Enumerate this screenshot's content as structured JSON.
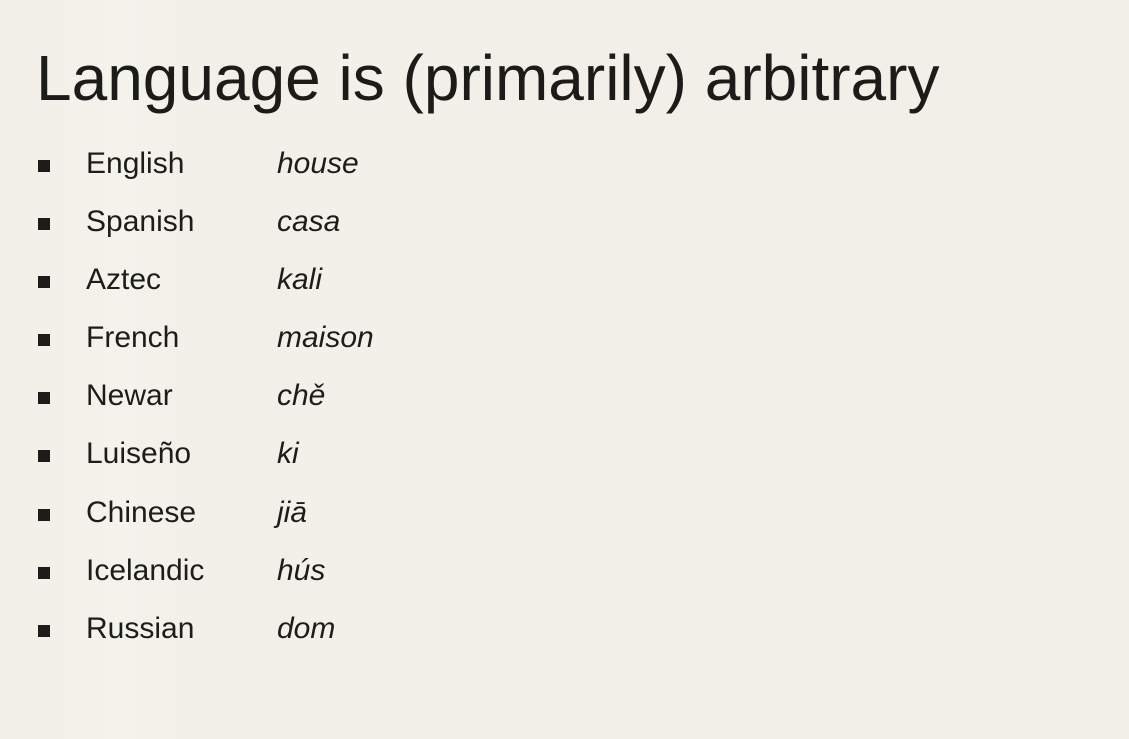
{
  "slide": {
    "title": "Language is (primarily) arbitrary",
    "rows": [
      {
        "language": "English",
        "word": "house"
      },
      {
        "language": "Spanish",
        "word": "casa"
      },
      {
        "language": "Aztec",
        "word": "kali"
      },
      {
        "language": "French",
        "word": "maison"
      },
      {
        "language": "Newar",
        "word": "chě"
      },
      {
        "language": "Luiseño",
        "word": "ki"
      },
      {
        "language": "Chinese",
        "word": "jiā"
      },
      {
        "language": "Icelandic",
        "word": "hús"
      },
      {
        "language": "Russian",
        "word": "dom"
      }
    ]
  },
  "colors": {
    "background": "#f1efe7",
    "text": "#1c1c1a"
  },
  "icons": {
    "bullet": "square-bullet-icon"
  }
}
